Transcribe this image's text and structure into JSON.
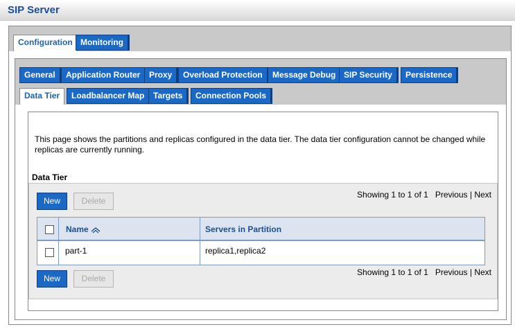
{
  "app": {
    "title": "SIP Server"
  },
  "outer_tabs": [
    {
      "label": "Configuration",
      "active": true
    },
    {
      "label": "Monitoring",
      "active": false
    }
  ],
  "inner_tabs_row1": [
    {
      "label": "General"
    },
    {
      "label": "Application Router"
    },
    {
      "label": "Proxy"
    },
    {
      "label": "Overload Protection"
    },
    {
      "label": "Message Debug"
    },
    {
      "label": "SIP Security"
    },
    {
      "label": "Persistence"
    }
  ],
  "inner_tabs_row2": [
    {
      "label": "Data Tier",
      "active": true
    },
    {
      "label": "Loadbalancer Map"
    },
    {
      "label": "Targets"
    },
    {
      "label": "Connection Pools"
    }
  ],
  "page": {
    "description": "This page shows the partitions and replicas configured in the data tier. The data tier configuration cannot be changed while replicas are currently running.",
    "section_title": "Data Tier"
  },
  "table": {
    "new_label": "New",
    "delete_label": "Delete",
    "pager": {
      "showing": "Showing 1 to 1 of 1",
      "previous": "Previous",
      "separator": "|",
      "next": "Next"
    },
    "columns": [
      "Name",
      "Servers in Partition"
    ],
    "rows": [
      {
        "name": "part-1",
        "servers": "replica1,replica2"
      }
    ]
  },
  "colors": {
    "accent": "#1a69c7",
    "header_text": "#1c4e91",
    "grid_border": "#7d9ac4",
    "grid_header_bg": "#dbe4ef"
  }
}
